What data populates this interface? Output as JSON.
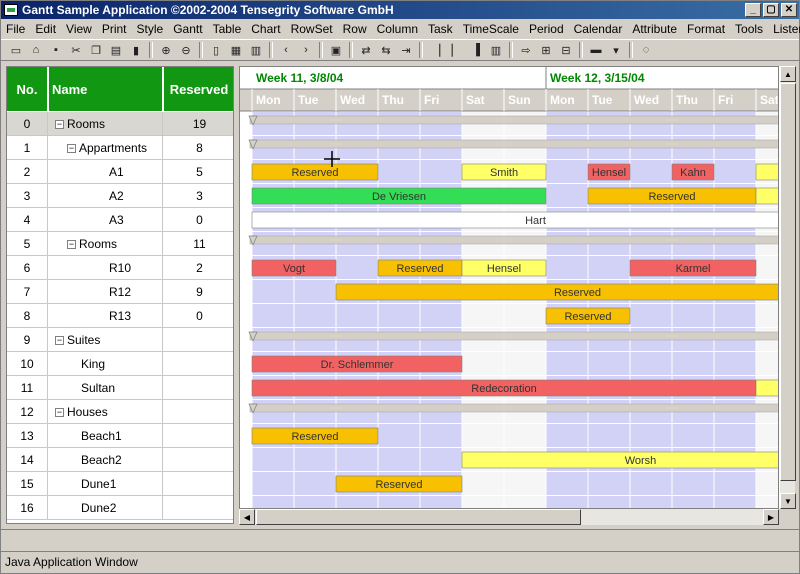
{
  "window": {
    "title": "Gantt Sample Application ©2002-2004 Tensegrity Software GmbH",
    "min_label": "_",
    "max_label": "▢",
    "close_label": "✕"
  },
  "menu": [
    "File",
    "Edit",
    "View",
    "Print",
    "Style",
    "Gantt",
    "Table",
    "Chart",
    "RowSet",
    "Row",
    "Column",
    "Task",
    "TimeScale",
    "Period",
    "Calendar",
    "Attribute",
    "Format",
    "Tools",
    "Listener",
    "?"
  ],
  "grid": {
    "headers": {
      "no": "No.",
      "name": "Name",
      "reserved": "Reserved"
    },
    "rows": [
      {
        "no": "0",
        "name": "Rooms",
        "reserved": "19",
        "level": 0,
        "expander": "−"
      },
      {
        "no": "1",
        "name": "Appartments",
        "reserved": "8",
        "level": 1,
        "expander": "−"
      },
      {
        "no": "2",
        "name": "A1",
        "reserved": "5",
        "level": 2,
        "expander": ""
      },
      {
        "no": "3",
        "name": "A2",
        "reserved": "3",
        "level": 2,
        "expander": ""
      },
      {
        "no": "4",
        "name": "A3",
        "reserved": "0",
        "level": 2,
        "expander": ""
      },
      {
        "no": "5",
        "name": "Rooms",
        "reserved": "11",
        "level": 1,
        "expander": "−"
      },
      {
        "no": "6",
        "name": "R10",
        "reserved": "2",
        "level": 2,
        "expander": ""
      },
      {
        "no": "7",
        "name": "R12",
        "reserved": "9",
        "level": 2,
        "expander": ""
      },
      {
        "no": "8",
        "name": "R13",
        "reserved": "0",
        "level": 2,
        "expander": ""
      },
      {
        "no": "9",
        "name": "Suites",
        "reserved": "",
        "level": 0,
        "expander": "−"
      },
      {
        "no": "10",
        "name": "King",
        "reserved": "",
        "level": 1,
        "expander": ""
      },
      {
        "no": "11",
        "name": "Sultan",
        "reserved": "",
        "level": 1,
        "expander": ""
      },
      {
        "no": "12",
        "name": "Houses",
        "reserved": "",
        "level": 0,
        "expander": "−"
      },
      {
        "no": "13",
        "name": "Beach1",
        "reserved": "",
        "level": 1,
        "expander": ""
      },
      {
        "no": "14",
        "name": "Beach2",
        "reserved": "",
        "level": 1,
        "expander": ""
      },
      {
        "no": "15",
        "name": "Dune1",
        "reserved": "",
        "level": 1,
        "expander": ""
      },
      {
        "no": "16",
        "name": "Dune2",
        "reserved": "",
        "level": 1,
        "expander": ""
      }
    ]
  },
  "timescale": {
    "weeks": [
      {
        "label": "Week 11, 3/8/04",
        "start": 0
      },
      {
        "label": "Week 12, 3/15/04",
        "start": 7
      }
    ],
    "days": [
      "Mon",
      "Tue",
      "Wed",
      "Thu",
      "Fri",
      "Sat",
      "Sun",
      "Mon",
      "Tue",
      "Wed",
      "Thu",
      "Fri",
      "Sat"
    ],
    "weekend": [
      5,
      6,
      12
    ]
  },
  "colors": {
    "reserved": "#f7c000",
    "booked_red": "#f26262",
    "booked_yellow": "#ffff66",
    "booked_green": "#33dd55",
    "working_day": "#d2d2f6",
    "weekend_day": "#f6f6f6",
    "header_green": "#119711",
    "week_text": "#008800"
  },
  "tasks": [
    {
      "row": 2,
      "start": 0,
      "end": 3,
      "label": "Reserved",
      "color": "reserved"
    },
    {
      "row": 2,
      "start": 5,
      "end": 7,
      "label": "Smith",
      "color": "booked_yellow"
    },
    {
      "row": 2,
      "start": 8,
      "end": 9,
      "label": "Hensel",
      "color": "booked_red"
    },
    {
      "row": 2,
      "start": 10,
      "end": 11,
      "label": "Kahn",
      "color": "booked_red"
    },
    {
      "row": 2,
      "start": 12,
      "end": 13.5,
      "label": "",
      "color": "booked_yellow"
    },
    {
      "row": 3,
      "start": 0,
      "end": 7,
      "label": "De Vriesen",
      "color": "booked_green"
    },
    {
      "row": 3,
      "start": 8,
      "end": 12,
      "label": "Reserved",
      "color": "reserved"
    },
    {
      "row": 3,
      "start": 12,
      "end": 13.5,
      "label": "",
      "color": "booked_yellow"
    },
    {
      "row": 4,
      "start": 0,
      "end": 13.5,
      "label": "Hart",
      "color": "white"
    },
    {
      "row": 6,
      "start": 0,
      "end": 2,
      "label": "Vogt",
      "color": "booked_red"
    },
    {
      "row": 6,
      "start": 3,
      "end": 5,
      "label": "Reserved",
      "color": "reserved"
    },
    {
      "row": 6,
      "start": 5,
      "end": 7,
      "label": "Hensel",
      "color": "booked_yellow"
    },
    {
      "row": 6,
      "start": 9,
      "end": 12,
      "label": "Karmel",
      "color": "booked_red"
    },
    {
      "row": 7,
      "start": 2,
      "end": 13.5,
      "label": "Reserved",
      "color": "reserved"
    },
    {
      "row": 8,
      "start": 7,
      "end": 9,
      "label": "Reserved",
      "color": "reserved"
    },
    {
      "row": 10,
      "start": 0,
      "end": 5,
      "label": "Dr. Schlemmer",
      "color": "booked_red"
    },
    {
      "row": 11,
      "start": 0,
      "end": 12,
      "label": "Redecoration",
      "color": "booked_red"
    },
    {
      "row": 11,
      "start": 12,
      "end": 13.5,
      "label": "",
      "color": "booked_yellow"
    },
    {
      "row": 13,
      "start": 0,
      "end": 3,
      "label": "Reserved",
      "color": "reserved"
    },
    {
      "row": 14,
      "start": 5,
      "end": 13.5,
      "label": "Worsh",
      "color": "booked_yellow"
    },
    {
      "row": 15,
      "start": 2,
      "end": 5,
      "label": "Reserved",
      "color": "reserved"
    }
  ],
  "status": "Java Application Window"
}
